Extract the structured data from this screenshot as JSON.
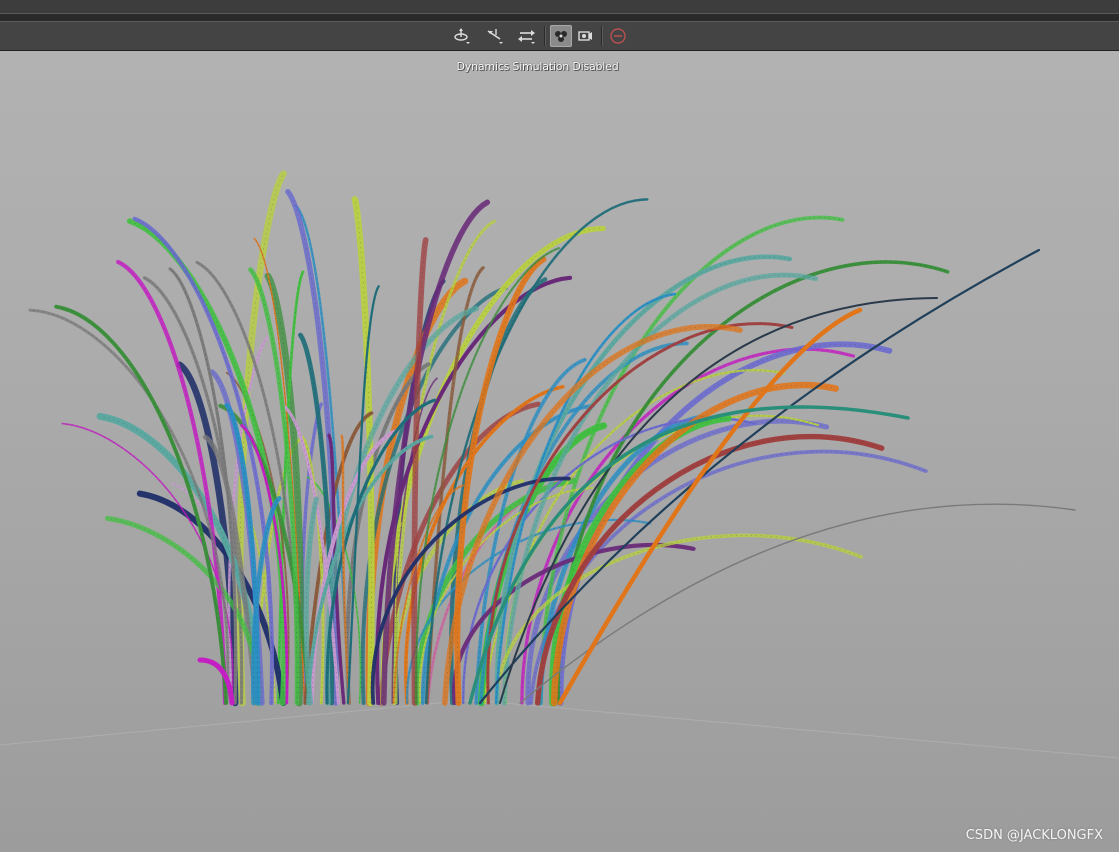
{
  "toolbar": {
    "buttons": [
      {
        "name": "rotate-tool",
        "icon": "rotate-icon",
        "state": "normal"
      },
      {
        "name": "move-tool",
        "icon": "move-icon",
        "state": "normal"
      },
      {
        "name": "transform-tool",
        "icon": "transform-icon",
        "state": "normal"
      },
      {
        "name": "dynamics-toggle",
        "icon": "dynamics-icon",
        "state": "active"
      },
      {
        "name": "camera-view",
        "icon": "camera-icon",
        "state": "normal"
      },
      {
        "name": "disable-simulation",
        "icon": "no-entry-icon",
        "state": "normal"
      }
    ]
  },
  "viewport": {
    "status_text": "Dynamics Simulation Disabled",
    "background_top": "#b3b3b3",
    "background_bottom": "#9c9c9c",
    "object": "grass-clump",
    "grass_colors": [
      "#c31fc2",
      "#2a8fc4",
      "#e0751a",
      "#1d6e7a",
      "#3a8f3a",
      "#6a2a7a",
      "#c89ad0",
      "#b8d040",
      "#1f2f6a",
      "#8a5a3a",
      "#5aa8a0",
      "#a04040",
      "#6a6ad0",
      "#40c040",
      "#d060a0",
      "#7a7a7a"
    ]
  },
  "watermark": "CSDN @JACKLONGFX"
}
